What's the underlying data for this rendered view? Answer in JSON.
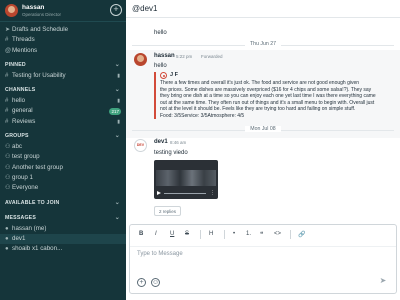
{
  "user": {
    "name": "hassan",
    "role": "Operations Director"
  },
  "sidebar": {
    "top_items": [
      {
        "icon": "drafts-icon",
        "label": "Drafts and Schedule"
      },
      {
        "icon": "threads-icon",
        "label": "Threads"
      },
      {
        "icon": "mentions-icon",
        "label": "Mentions"
      }
    ],
    "pinned": {
      "title": "PINNED",
      "items": [
        {
          "label": "Testing for Usability"
        }
      ]
    },
    "channels": {
      "title": "CHANNELS",
      "items": [
        {
          "label": "hello",
          "pinned": true
        },
        {
          "label": "general",
          "badge": "217"
        },
        {
          "label": "Reviews",
          "pinned": true
        }
      ]
    },
    "groups": {
      "title": "GROUPS",
      "items": [
        {
          "label": "abc"
        },
        {
          "label": "test group"
        },
        {
          "label": "Another test group"
        },
        {
          "label": "group 1"
        },
        {
          "label": "Everyone"
        }
      ]
    },
    "available": {
      "title": "AVAILABLE TO JOIN"
    },
    "messages": {
      "title": "MESSAGES",
      "items": [
        {
          "label": "hassan (me)"
        },
        {
          "label": "dev1"
        },
        {
          "label": "shoaib x1 cabon..."
        }
      ]
    }
  },
  "header": {
    "title": "@dev1"
  },
  "messages": {
    "first_line": "hello",
    "date_1": "Thu Jun 27",
    "msg1": {
      "author": "hassan",
      "time": "5:22 pm",
      "tag": "Forwarded",
      "text": "hello",
      "quote": {
        "author": "J F",
        "lines": [
          "There a few times and overall it's just ok. The food and service are not good enough given",
          "the prices. Some dishes are massively overpriced ($16 for 4 chips and some salsa!?). They say",
          "they bring one dish at a time so you can enjoy each one yet last time I was there everything came",
          "out at the same time. They often run out of things and it's a small menu to begin with. Overall just",
          "not at the level it should be. Feels like they are trying too hard and failing on simple stuff.",
          "Food: 3/5Service: 3/5Atmosphere: 4/5"
        ]
      }
    },
    "date_2": "Mon Jul 08",
    "msg2": {
      "author": "dev1",
      "avatar_text": "DEV",
      "time": "8:46 am",
      "text": "testing viedo",
      "replies": "2 replies"
    }
  },
  "composer": {
    "placeholder": "Type to Message",
    "toolbar": [
      "B",
      "I",
      "U",
      "S",
      "H",
      "•",
      "1.",
      "❝",
      "<>",
      "🔗"
    ]
  },
  "colors": {
    "sidebar_bg": "#15353a",
    "accent_green": "#3fa27e",
    "quote_red": "#d24b3a"
  }
}
